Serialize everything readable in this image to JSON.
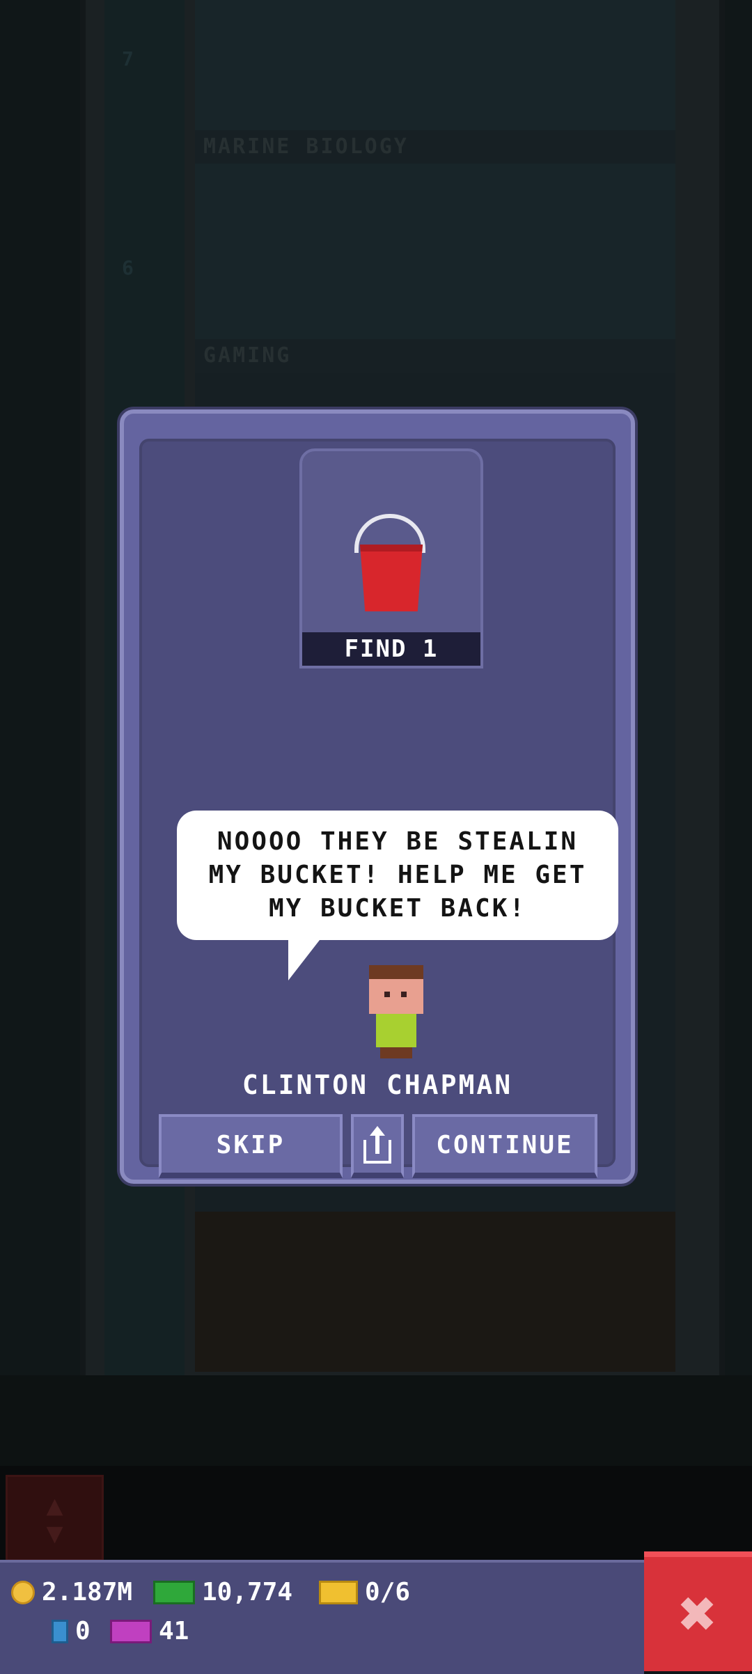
{
  "tower": {
    "floors": [
      {
        "number": "7",
        "label": "MARINE BIOLOGY"
      },
      {
        "number": "6",
        "label": "GAMING"
      }
    ]
  },
  "dialog": {
    "mission_label": "FIND 1",
    "mission_item_icon": "bucket-icon",
    "speech": "NOOOO THEY BE STEALIN MY BUCKET! HELP ME GET MY BUCKET BACK!",
    "npc_name": "CLINTON CHAPMAN",
    "skip_label": "SKIP",
    "share_icon": "share-icon",
    "continue_label": "CONTINUE"
  },
  "hud": {
    "coins": "2.187M",
    "bux": "10,774",
    "tickets": "0/6",
    "blue_count": "0",
    "vip_count": "41",
    "close_icon": "close-icon"
  },
  "colors": {
    "dialog_bg": "#4c4c7c",
    "button_bg": "#6a6aa4",
    "close_red": "#d8323a",
    "bucket_red": "#d8262c"
  }
}
